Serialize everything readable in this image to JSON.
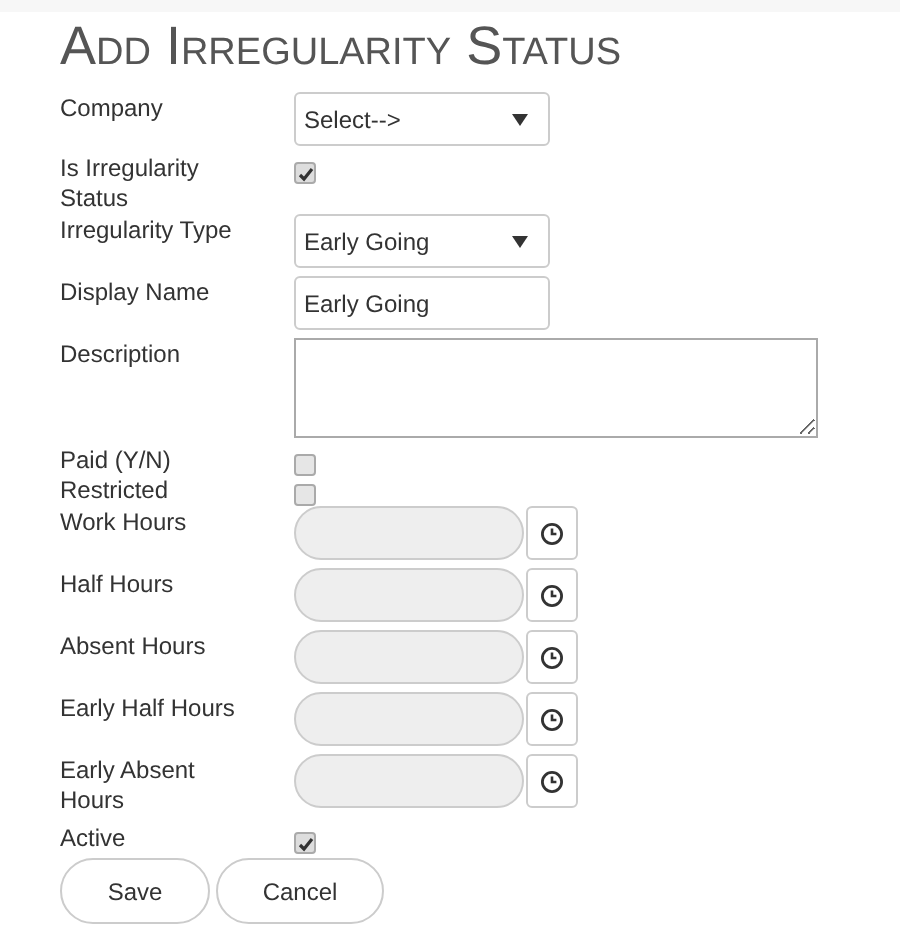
{
  "title": "Add Irregularity Status",
  "fields": [
    {
      "kind": "select",
      "label": "Company",
      "value": "Select-->"
    },
    {
      "kind": "checkbox",
      "label": "Is Irregularity Status",
      "checked": true
    },
    {
      "kind": "select",
      "label": "Irregularity Type",
      "value": "Early Going"
    },
    {
      "kind": "text",
      "label": "Display Name",
      "value": "Early Going"
    },
    {
      "kind": "textarea",
      "label": "Description"
    },
    {
      "kind": "checkbox",
      "label": "Paid (Y/N)",
      "checked": false
    },
    {
      "kind": "checkbox",
      "label": "Restricted",
      "checked": false
    },
    {
      "kind": "time",
      "label": "Work Hours",
      "disabled": true
    },
    {
      "kind": "time",
      "label": "Half Hours",
      "disabled": true
    },
    {
      "kind": "time",
      "label": "Absent Hours",
      "disabled": true
    },
    {
      "kind": "time",
      "label": "Early Half Hours",
      "disabled": true
    },
    {
      "kind": "time",
      "label": "Early Absent Hours",
      "disabled": true
    },
    {
      "kind": "checkbox",
      "label": "Active",
      "checked": true
    }
  ],
  "buttons": [
    "Save",
    "Cancel"
  ]
}
